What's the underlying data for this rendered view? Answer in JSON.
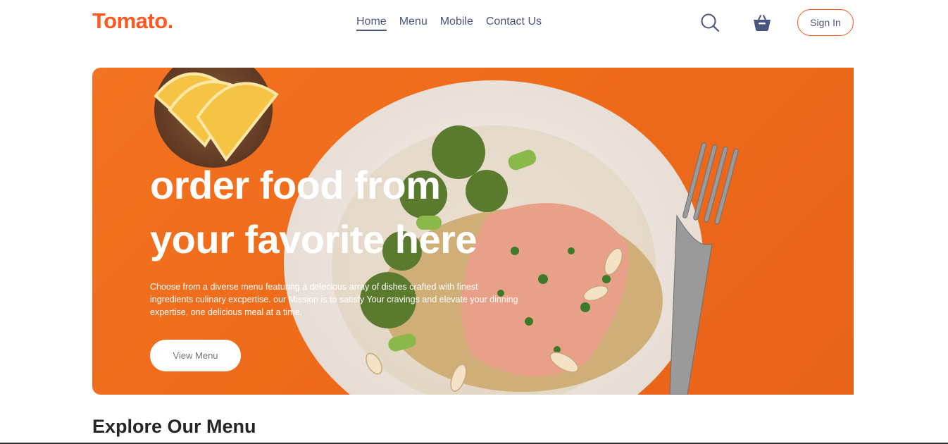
{
  "brand": {
    "logo_text": "Tomato.",
    "accent": "#ff5722",
    "text_color": "#49557e"
  },
  "nav": {
    "items": [
      {
        "label": "Home",
        "active": true
      },
      {
        "label": "Menu",
        "active": false
      },
      {
        "label": "Mobile",
        "active": false
      },
      {
        "label": "Contact Us",
        "active": false
      }
    ],
    "search_icon": "search-icon",
    "basket_icon": "basket-icon",
    "signin_label": "Sign In"
  },
  "hero": {
    "title_line1": "order food from",
    "title_line2": "your favorite here",
    "description": "Choose from a diverse menu featuring a delecious array of dishes crafted with finest ingredients culinary excpertise. our Mission is to satisfy Your cravings and elevate your dinning expertise, one delicious meal at a time.",
    "button_label": "View Menu",
    "background": "#f27321"
  },
  "explore": {
    "title": "Explore Our Menu"
  }
}
